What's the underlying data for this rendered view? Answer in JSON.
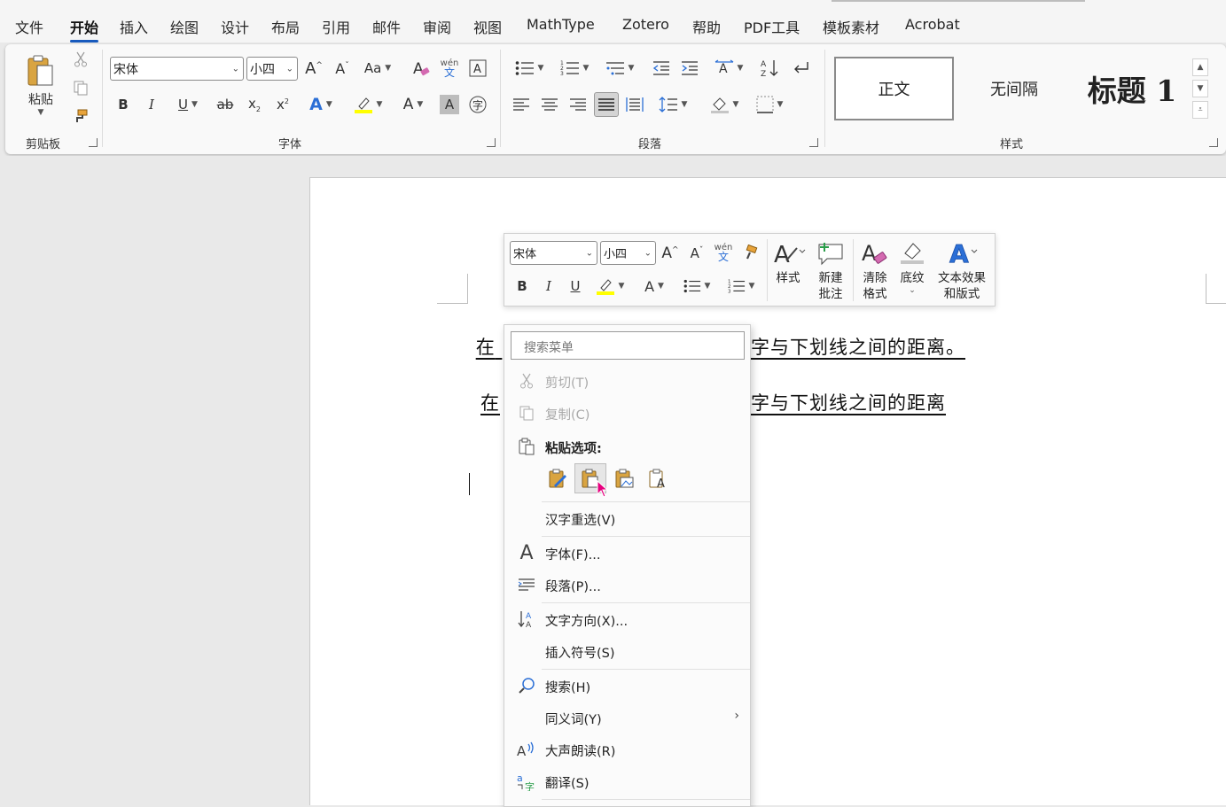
{
  "menu_tabs": [
    "文件",
    "开始",
    "插入",
    "绘图",
    "设计",
    "布局",
    "引用",
    "邮件",
    "审阅",
    "视图",
    "MathType",
    "Zotero",
    "帮助",
    "PDF工具",
    "模板素材",
    "Acrobat"
  ],
  "active_tab": "开始",
  "ribbon": {
    "clipboard": {
      "paste_label": "粘贴",
      "group_label": "剪贴板"
    },
    "font": {
      "font_name": "宋体",
      "font_size": "小四",
      "group_label": "字体",
      "change_case": "Aa",
      "phonetic": "wén",
      "phonetic_sub": "文"
    },
    "paragraph": {
      "group_label": "段落"
    },
    "styles": {
      "group_label": "样式",
      "items": [
        "正文",
        "无间隔",
        "标题 1"
      ]
    }
  },
  "document": {
    "line1_left": "在",
    "line1_right": "字与下划线之间的距离。",
    "line2_left": "在",
    "line2_right": "字与下划线之间的距离"
  },
  "mini_toolbar": {
    "font_name": "宋体",
    "font_size": "小四",
    "phonetic": "wén",
    "phonetic_sub": "文",
    "styles_label": "样式",
    "new_comment_label": [
      "新建",
      "批注"
    ],
    "clear_format_label": [
      "清除",
      "格式"
    ],
    "shading_label": "底纹",
    "text_effects_label": [
      "文本效果",
      "和版式"
    ]
  },
  "context_menu": {
    "search_placeholder": "搜索菜单",
    "cut": "剪切(T)",
    "copy": "复制(C)",
    "paste_options": "粘贴选项:",
    "reconvert": "汉字重选(V)",
    "font": "字体(F)...",
    "paragraph": "段落(P)...",
    "text_direction": "文字方向(X)...",
    "insert_symbol": "插入符号(S)",
    "search": "搜索(H)",
    "synonyms": "同义词(Y)",
    "read_aloud": "大声朗读(R)",
    "translate": "翻译(S)"
  },
  "colors": {
    "accent": "#185abd",
    "highlight": "#ffff00",
    "text_effect": "#2b6fd6"
  }
}
